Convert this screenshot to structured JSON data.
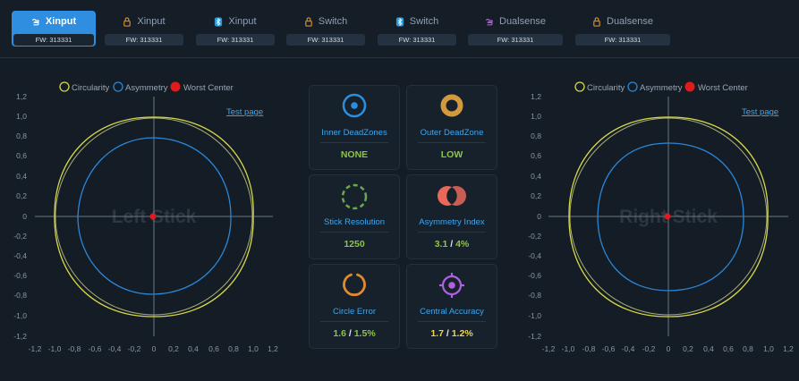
{
  "controllers": [
    {
      "name": "Xinput",
      "fw": "FW: 313331",
      "icon": "controller-gamepad-icon",
      "active": true
    },
    {
      "name": "Xinput",
      "fw": "FW: 313331",
      "icon": "padlock-icon",
      "active": false
    },
    {
      "name": "Xinput",
      "fw": "FW: 313331",
      "icon": "bluetooth-icon",
      "active": false
    },
    {
      "name": "Switch",
      "fw": "FW: 313331",
      "icon": "padlock-icon",
      "active": false
    },
    {
      "name": "Switch",
      "fw": "FW: 313331",
      "icon": "bluetooth-icon",
      "active": false
    },
    {
      "name": "Dualsense",
      "fw": "FW: 313331",
      "icon": "controller-gamepad-icon",
      "active": false
    },
    {
      "name": "Dualsense",
      "fw": "FW: 313331",
      "icon": "padlock-icon",
      "active": false
    }
  ],
  "legend": {
    "circularity": "Circularity",
    "asymmetry": "Asymmetry",
    "worst_center": "Worst Center"
  },
  "left_plot": {
    "title": "Left Stick",
    "test_link": "Test page"
  },
  "right_plot": {
    "title": "Right Stick",
    "test_link": "Test page"
  },
  "axis_ticks": [
    "-1,2",
    "-1,0",
    "-0,8",
    "-0,6",
    "-0,4",
    "-0,2",
    "0",
    "0,2",
    "0,4",
    "0,6",
    "0,8",
    "1,0",
    "1,2"
  ],
  "metrics": [
    {
      "label": "Inner DeadZones",
      "value": "NONE",
      "value_color": "green",
      "icon": "inner-deadzone-icon"
    },
    {
      "label": "Outer DeadZone",
      "value": "LOW",
      "value_color": "green",
      "icon": "outer-deadzone-icon"
    },
    {
      "label": "Stick Resolution",
      "value": "1250",
      "value_color": "green",
      "icon": "dashed-circle-icon"
    },
    {
      "label": "Asymmetry Index",
      "value_a": "3.1",
      "value_sep": " / ",
      "value_b": "4%",
      "value_color": "green",
      "icon": "overlap-circles-icon"
    },
    {
      "label": "Circle Error",
      "value_a": "1.6",
      "value_sep": " / ",
      "value_b": "1.5%",
      "value_color": "green",
      "icon": "open-ring-icon"
    },
    {
      "label": "Central Accuracy",
      "value_a": "1.7",
      "value_sep": " / ",
      "value_b": "1.2%",
      "value_color": "yellow",
      "icon": "target-icon"
    }
  ],
  "colors": {
    "accent": "#2f8ee0",
    "circularity": "#d8d84a",
    "asymmetry": "#2a86d8",
    "worst_center": "#e01b1b",
    "good": "#8dc63f",
    "warn": "#f1d54b",
    "label": "#3ea6f0"
  }
}
